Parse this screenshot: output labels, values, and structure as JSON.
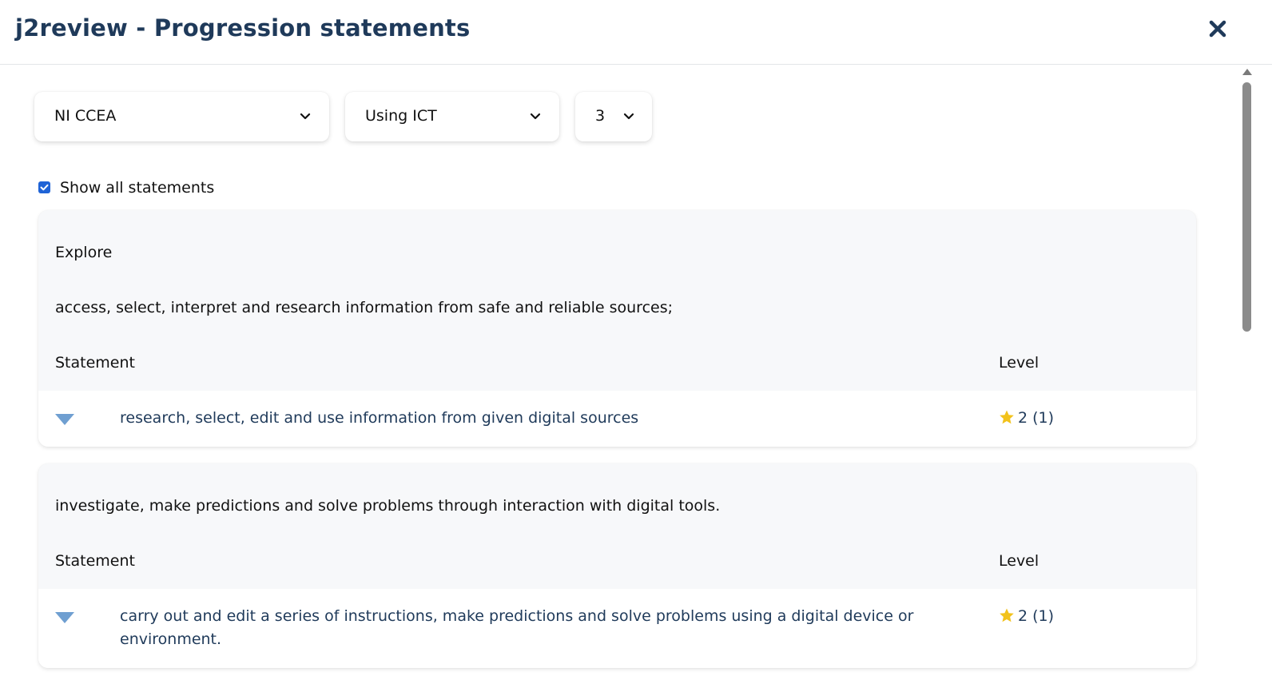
{
  "window": {
    "title": "j2review - Progression statements",
    "close_icon": "close-icon"
  },
  "filters": {
    "curriculum": {
      "selected": "NI CCEA"
    },
    "subject": {
      "selected": "Using ICT"
    },
    "level": {
      "selected": "3"
    }
  },
  "show_all": {
    "label": "Show all statements",
    "checked": true
  },
  "colors": {
    "accent": "#1f63d6",
    "title": "#1f3a5a",
    "star": "#f2c21b",
    "triangle": "#6f9fd1"
  },
  "sections": [
    {
      "heading": "Explore",
      "description": "access, select, interpret and research information from safe and reliable sources;",
      "col_statement": "Statement",
      "col_level": "Level",
      "rows": [
        {
          "statement": "research, select, edit and use information from given digital sources",
          "level": "2 (1)"
        }
      ]
    },
    {
      "heading": "",
      "description": "investigate, make predictions and solve problems through interaction with digital tools.",
      "col_statement": "Statement",
      "col_level": "Level",
      "rows": [
        {
          "statement": "carry out and edit a series of instructions, make predictions and solve problems using a digital device or environment.",
          "level": "2 (1)"
        }
      ]
    }
  ]
}
